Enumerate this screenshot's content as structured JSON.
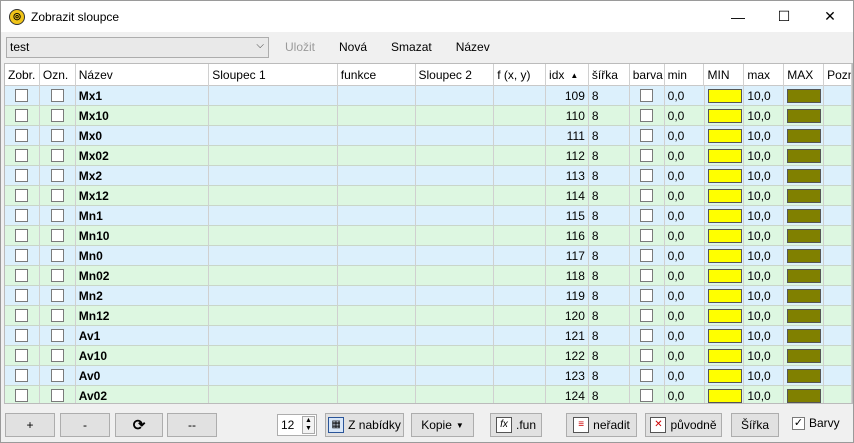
{
  "window": {
    "title": "Zobrazit sloupce",
    "minimize": "—",
    "maximize": "☐",
    "close": "✕"
  },
  "toolbar": {
    "combo_value": "test",
    "save": "Uložit",
    "new": "Nová",
    "delete": "Smazat",
    "name": "Název"
  },
  "columns": [
    "Zobr.",
    "Ozn.",
    "Název",
    "Sloupec 1",
    "funkce",
    "Sloupec 2",
    "f (x, y)",
    "idx",
    "šířka",
    "barva",
    "min",
    "MIN",
    "max",
    "MAX",
    "Pozna"
  ],
  "sort_indicator": "▲",
  "rows": [
    {
      "name": "Mx1",
      "idx": "109",
      "width": "8",
      "min": "0,0",
      "max": "10,0"
    },
    {
      "name": "Mx10",
      "idx": "110",
      "width": "8",
      "min": "0,0",
      "max": "10,0"
    },
    {
      "name": "Mx0",
      "idx": "111",
      "width": "8",
      "min": "0,0",
      "max": "10,0"
    },
    {
      "name": "Mx02",
      "idx": "112",
      "width": "8",
      "min": "0,0",
      "max": "10,0"
    },
    {
      "name": "Mx2",
      "idx": "113",
      "width": "8",
      "min": "0,0",
      "max": "10,0"
    },
    {
      "name": "Mx12",
      "idx": "114",
      "width": "8",
      "min": "0,0",
      "max": "10,0"
    },
    {
      "name": "Mn1",
      "idx": "115",
      "width": "8",
      "min": "0,0",
      "max": "10,0"
    },
    {
      "name": "Mn10",
      "idx": "116",
      "width": "8",
      "min": "0,0",
      "max": "10,0"
    },
    {
      "name": "Mn0",
      "idx": "117",
      "width": "8",
      "min": "0,0",
      "max": "10,0"
    },
    {
      "name": "Mn02",
      "idx": "118",
      "width": "8",
      "min": "0,0",
      "max": "10,0"
    },
    {
      "name": "Mn2",
      "idx": "119",
      "width": "8",
      "min": "0,0",
      "max": "10,0"
    },
    {
      "name": "Mn12",
      "idx": "120",
      "width": "8",
      "min": "0,0",
      "max": "10,0"
    },
    {
      "name": "Av1",
      "idx": "121",
      "width": "8",
      "min": "0,0",
      "max": "10,0"
    },
    {
      "name": "Av10",
      "idx": "122",
      "width": "8",
      "min": "0,0",
      "max": "10,0"
    },
    {
      "name": "Av0",
      "idx": "123",
      "width": "8",
      "min": "0,0",
      "max": "10,0"
    },
    {
      "name": "Av02",
      "idx": "124",
      "width": "8",
      "min": "0,0",
      "max": "10,0"
    }
  ],
  "colors": {
    "row_blue": "#dcf0fc",
    "row_green": "#ddf7e1",
    "min_swatch": "#ffff00",
    "max_swatch": "#808000"
  },
  "bottom": {
    "plus": "+",
    "minus": "-",
    "refresh": "⟳",
    "dashdash": "--",
    "spin_value": "12",
    "from_menu": "Z nabídky",
    "copy": "Kopie",
    "fun": ".fun",
    "unsort": "neřadit",
    "original": "původně",
    "width": "Šířka",
    "colors_label": "Barvy"
  }
}
